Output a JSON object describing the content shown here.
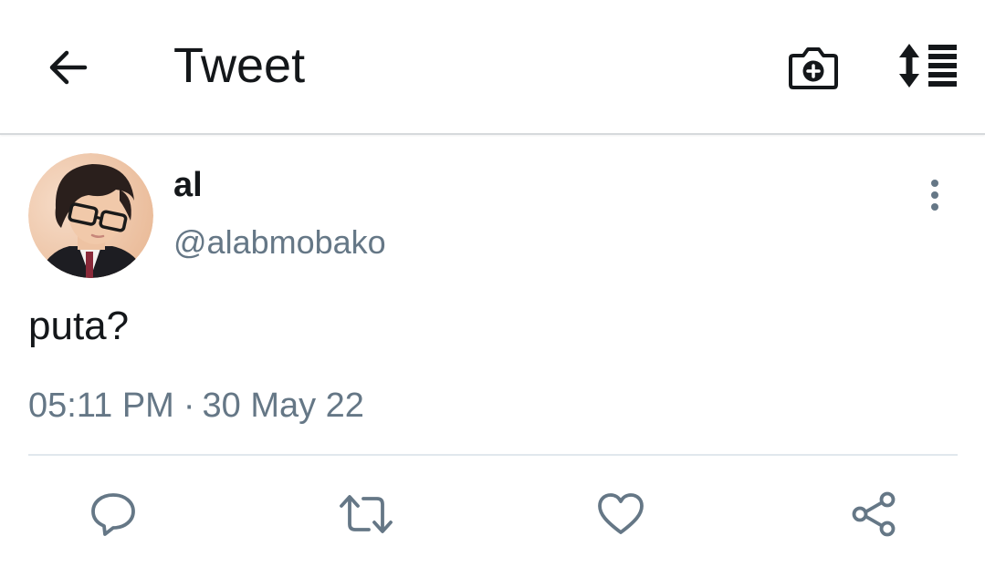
{
  "header": {
    "title": "Tweet",
    "back_icon": "arrow-left-icon",
    "camera_icon": "camera-plus-icon",
    "sort_icon": "sort-list-icon"
  },
  "tweet": {
    "author": {
      "display_name": "al",
      "handle": "@alabmobako",
      "avatar_icon": "profile-photo"
    },
    "text": "puta?",
    "time": "05:11 PM",
    "separator": "·",
    "date": "30 May 22",
    "more_icon": "more-vertical-icon"
  },
  "actions": [
    {
      "name": "reply",
      "icon": "reply-icon"
    },
    {
      "name": "retweet",
      "icon": "retweet-icon"
    },
    {
      "name": "like",
      "icon": "heart-icon"
    },
    {
      "name": "share",
      "icon": "share-icon"
    }
  ],
  "colors": {
    "primary_text": "#14171a",
    "secondary_text": "#657786",
    "icon": "#657786",
    "divider": "#e1e8ed",
    "header_border": "#d6d9dc"
  }
}
